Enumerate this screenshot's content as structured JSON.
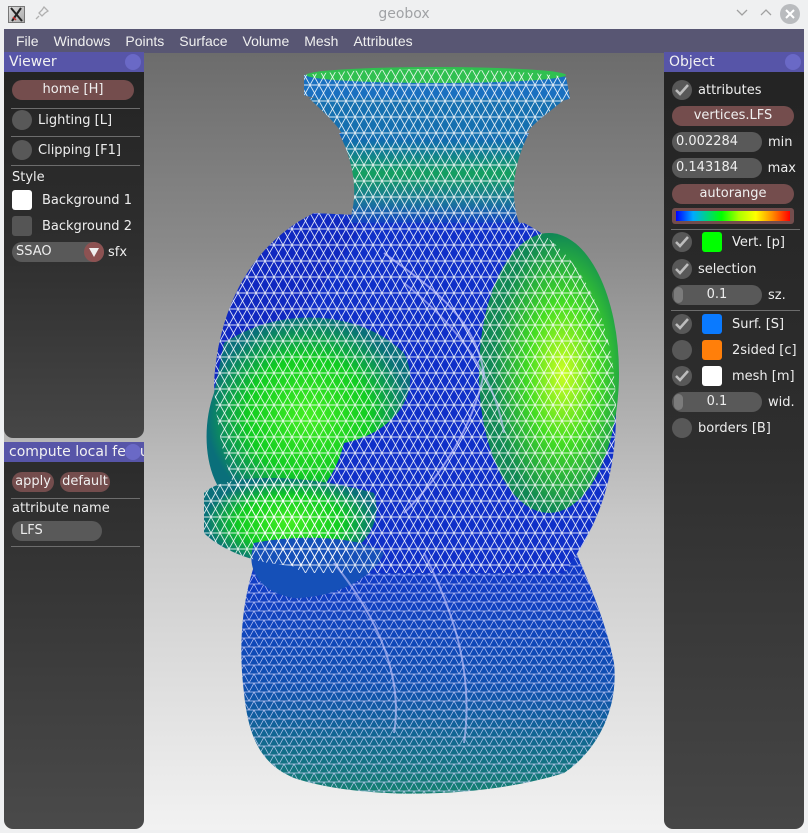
{
  "window": {
    "title": "geobox",
    "controls": [
      "minimize-icon",
      "maximize-icon",
      "close-icon"
    ]
  },
  "menubar": {
    "items": [
      "File",
      "Windows",
      "Points",
      "Surface",
      "Volume",
      "Mesh",
      "Attributes"
    ]
  },
  "viewer_panel": {
    "title": "Viewer",
    "home_button": "home [H]",
    "lighting": {
      "label": "Lighting [L]",
      "checked": false
    },
    "clipping": {
      "label": "Clipping [F1]",
      "checked": false
    },
    "style_heading": "Style",
    "background1": {
      "label": "Background 1",
      "color": "#ffffff"
    },
    "background2": {
      "label": "Background 2",
      "color": "#555555"
    },
    "effect": {
      "selected": "SSAO",
      "label": "sfx"
    }
  },
  "compute_panel": {
    "title": "compute local feature size",
    "apply_button": "apply",
    "default_button": "default",
    "attribute_name_label": "attribute name",
    "attribute_name_value": "LFS"
  },
  "object_panel": {
    "title": "Object",
    "attributes": {
      "label": "attributes",
      "checked": true
    },
    "attribute_button": "vertices.LFS",
    "min": {
      "value": "0.002284",
      "label": "min"
    },
    "max": {
      "value": "0.143184",
      "label": "max"
    },
    "autorange_button": "autorange",
    "colormap": "rainbow (blue→red)",
    "vertices": {
      "label": "Vert. [p]",
      "checked": true,
      "color": "#00ff00"
    },
    "selection": {
      "label": "selection",
      "checked": true
    },
    "point_size": {
      "value": "0.1",
      "label": "sz."
    },
    "surface": {
      "label": "Surf. [S]",
      "checked": true,
      "color": "#0a7aff"
    },
    "two_sided": {
      "label": "2sided [c]",
      "checked": false,
      "color": "#ff7f0a"
    },
    "mesh": {
      "label": "mesh [m]",
      "checked": true,
      "color": "#ffffff"
    },
    "mesh_width": {
      "value": "0.1",
      "label": "wid."
    },
    "borders": {
      "label": "borders [B]",
      "checked": false
    }
  },
  "viewport": {
    "content": "triangulated lion-head vase mesh colored by LFS attribute"
  }
}
